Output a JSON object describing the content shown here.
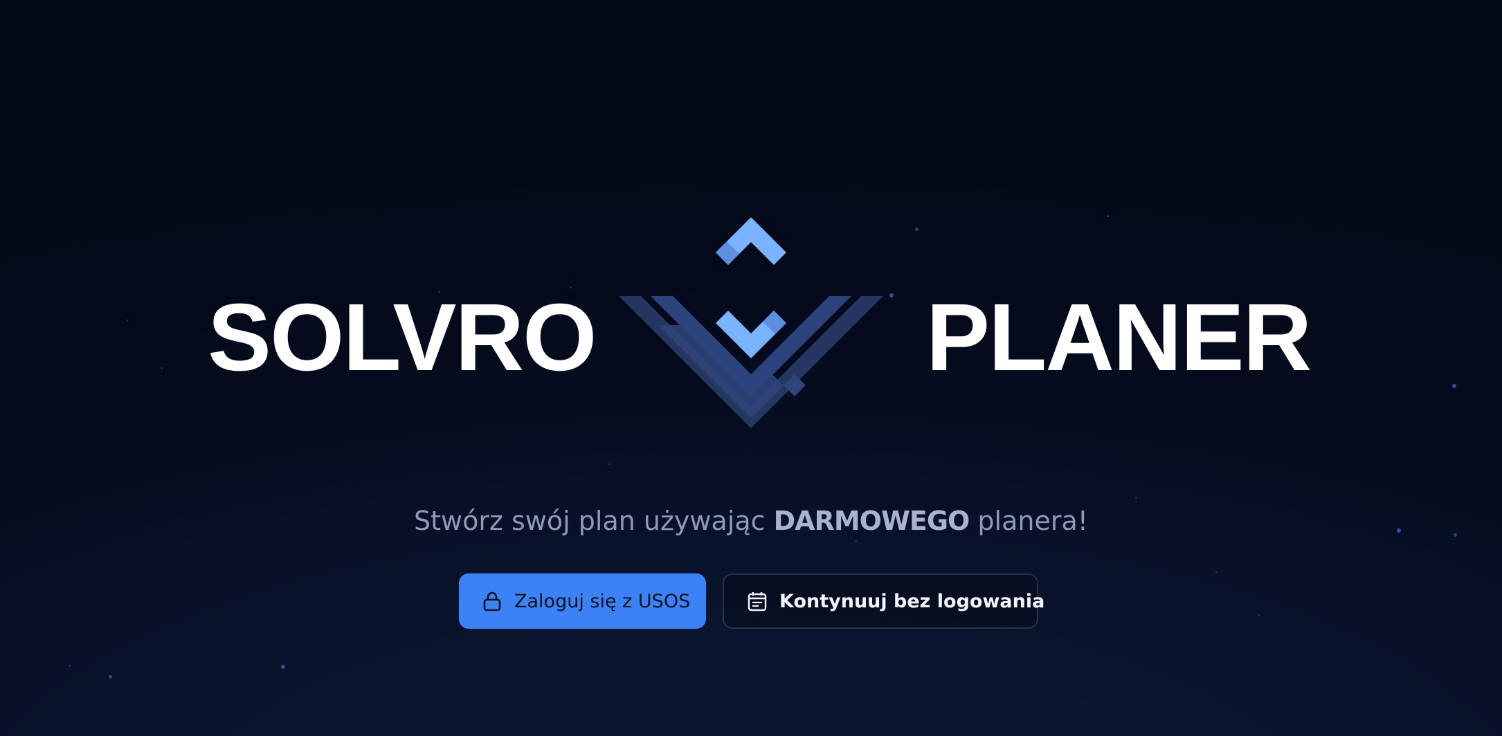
{
  "brand": {
    "left_word": "SOLVRO",
    "right_word": "PLANER",
    "logo_icon": "solvro-s-chevron-logo",
    "accent_color": "#7ab3ff",
    "chevron_color": "#2f4478"
  },
  "hero": {
    "tagline_before": "Stwórz swój plan używając ",
    "tagline_emphasis": "DARMOWEGO",
    "tagline_after": " planera!"
  },
  "actions": {
    "login": {
      "label": "Zaloguj się z USOS",
      "icon": "lock-icon",
      "color": "#3b82f6"
    },
    "guest": {
      "label": "Kontynuuj bez logowania",
      "icon": "calendar-icon"
    }
  },
  "background": {
    "color": "#050b1d"
  }
}
